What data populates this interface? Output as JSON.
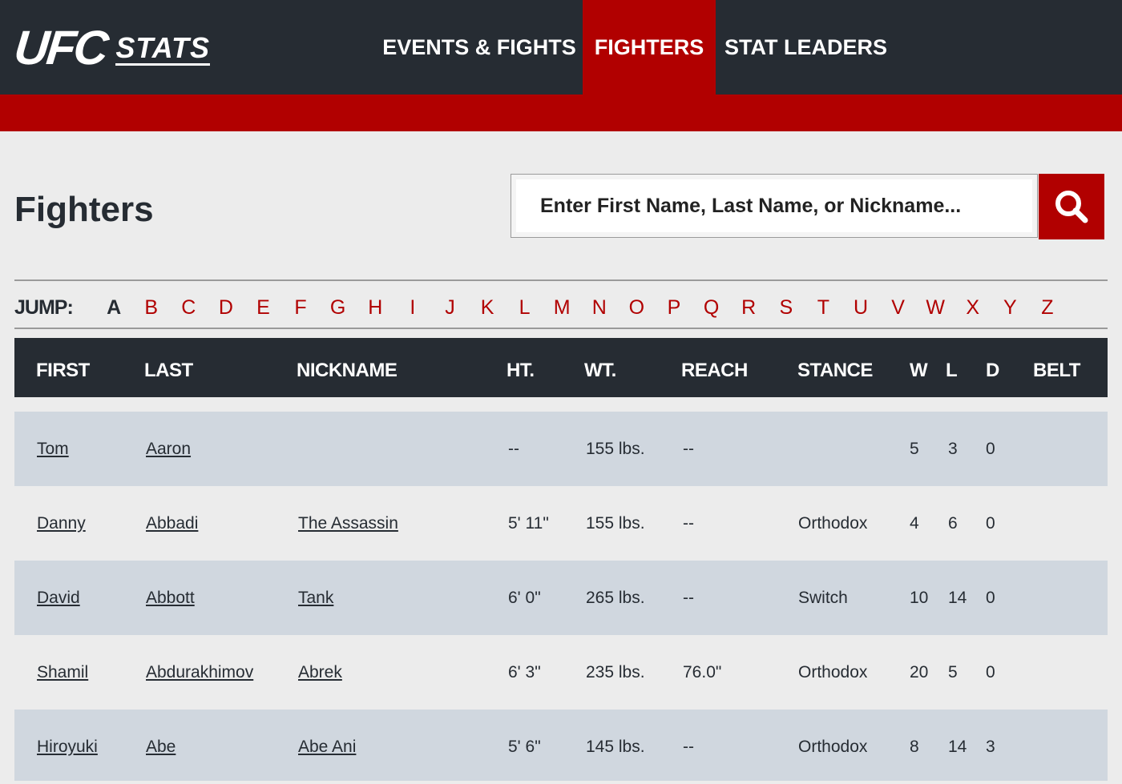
{
  "header": {
    "logo_main": "UFC",
    "logo_sub": "STATS",
    "nav": [
      {
        "label": "EVENTS & FIGHTS",
        "active": false
      },
      {
        "label": "FIGHTERS",
        "active": true
      },
      {
        "label": "STAT LEADERS",
        "active": false
      }
    ]
  },
  "page": {
    "title": "Fighters"
  },
  "search": {
    "placeholder": "Enter First Name, Last Name, or Nickname...",
    "button_icon": "search-icon"
  },
  "jump": {
    "label": "JUMP:",
    "current": "A",
    "letters": [
      "A",
      "B",
      "C",
      "D",
      "E",
      "F",
      "G",
      "H",
      "I",
      "J",
      "K",
      "L",
      "M",
      "N",
      "O",
      "P",
      "Q",
      "R",
      "S",
      "T",
      "U",
      "V",
      "W",
      "X",
      "Y",
      "Z"
    ]
  },
  "table": {
    "columns": [
      "FIRST",
      "LAST",
      "NICKNAME",
      "HT.",
      "WT.",
      "REACH",
      "STANCE",
      "W",
      "L",
      "D",
      "BELT"
    ],
    "rows": [
      {
        "first": "Tom",
        "last": "Aaron",
        "nickname": "",
        "ht": "--",
        "wt": "155 lbs.",
        "reach": "--",
        "stance": "",
        "w": "5",
        "l": "3",
        "d": "0",
        "belt": ""
      },
      {
        "first": "Danny",
        "last": "Abbadi",
        "nickname": "The Assassin",
        "ht": "5' 11\"",
        "wt": "155 lbs.",
        "reach": "--",
        "stance": "Orthodox",
        "w": "4",
        "l": "6",
        "d": "0",
        "belt": ""
      },
      {
        "first": "David",
        "last": "Abbott",
        "nickname": "Tank",
        "ht": "6' 0\"",
        "wt": "265 lbs.",
        "reach": "--",
        "stance": "Switch",
        "w": "10",
        "l": "14",
        "d": "0",
        "belt": ""
      },
      {
        "first": "Shamil",
        "last": "Abdurakhimov",
        "nickname": "Abrek",
        "ht": "6' 3\"",
        "wt": "235 lbs.",
        "reach": "76.0\"",
        "stance": "Orthodox",
        "w": "20",
        "l": "5",
        "d": "0",
        "belt": ""
      },
      {
        "first": "Hiroyuki",
        "last": "Abe",
        "nickname": "Abe Ani",
        "ht": "5' 6\"",
        "wt": "145 lbs.",
        "reach": "--",
        "stance": "Orthodox",
        "w": "8",
        "l": "14",
        "d": "3",
        "belt": ""
      }
    ]
  },
  "colors": {
    "brand_red": "#b10000",
    "dark": "#262c33",
    "row_shade": "#d0d7df",
    "background": "#ececec"
  }
}
